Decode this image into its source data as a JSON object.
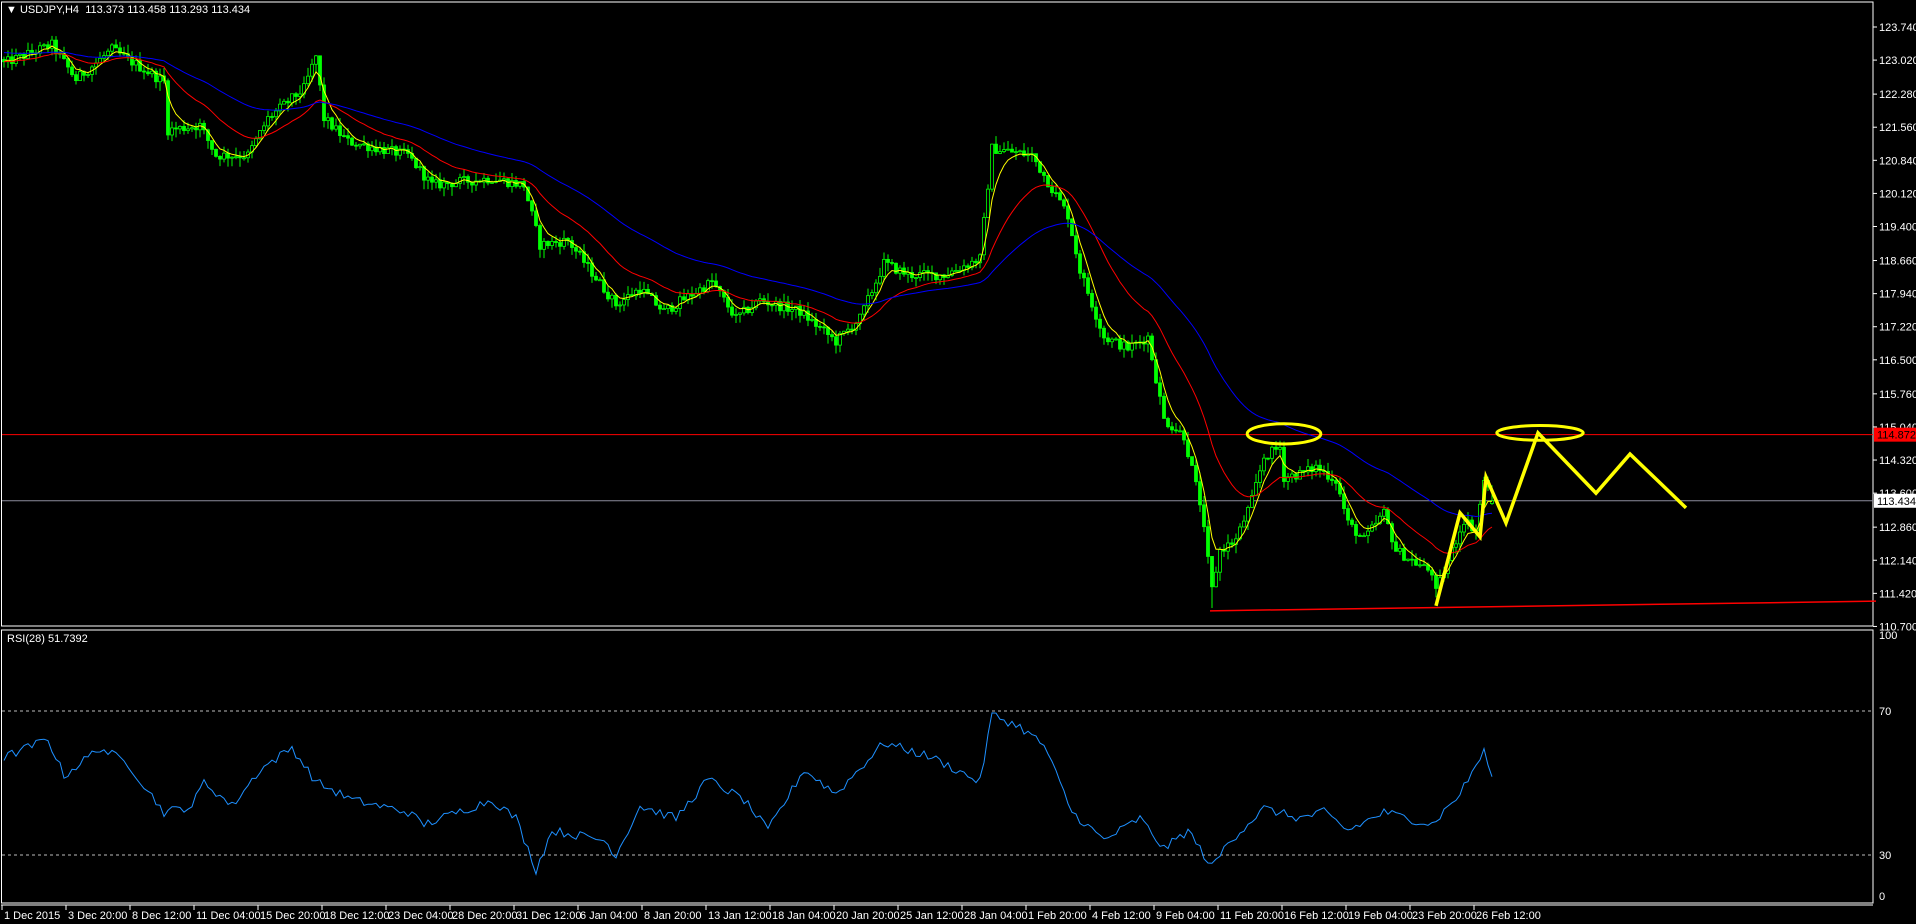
{
  "window": {
    "menu_arrow_icon": "triangle-down",
    "symbol_header": "USDJPY,H4",
    "ohlc": "113.373 113.458 113.293 113.434"
  },
  "indicator": {
    "label": "RSI(28) 51.7392"
  },
  "colors": {
    "background": "#000000",
    "candle": "#00ff00",
    "axis": "#ffffff",
    "ma_fast": "#ffff00",
    "ma_mid": "#ff0000",
    "ma_slow": "#0000ff",
    "resistance": "#ff0000",
    "current": "#8c8c9c",
    "trendline": "#ff0000",
    "annotation": "#ffff00",
    "rsi": "#1e90ff"
  },
  "chart_data": {
    "type": "candlestick",
    "symbol": "USDJPY",
    "timeframe": "H4",
    "last": {
      "open": 113.373,
      "high": 113.458,
      "low": 113.293,
      "close": 113.434
    },
    "price_axis": {
      "min": 110.7,
      "max": 123.74,
      "labels": [
        "123.740",
        "123.020",
        "122.280",
        "121.560",
        "120.840",
        "120.120",
        "119.400",
        "118.660",
        "117.940",
        "117.220",
        "116.500",
        "115.760",
        "115.040",
        "114.320",
        "113.600",
        "112.860",
        "112.140",
        "111.420",
        "110.700"
      ]
    },
    "time_labels": [
      "1 Dec 2015",
      "3 Dec 20:00",
      "8 Dec 12:00",
      "11 Dec 04:00",
      "15 Dec 20:00",
      "18 Dec 12:00",
      "23 Dec 04:00",
      "28 Dec 20:00",
      "31 Dec 12:00",
      "6 Jan 04:00",
      "8 Jan 20:00",
      "13 Jan 12:00",
      "18 Jan 04:00",
      "20 Jan 20:00",
      "25 Jan 12:00",
      "28 Jan 04:00",
      "1 Feb 20:00",
      "4 Feb 12:00",
      "9 Feb 04:00",
      "11 Feb 20:00",
      "16 Feb 12:00",
      "19 Feb 04:00",
      "23 Feb 20:00",
      "26 Feb 12:00"
    ],
    "bars_per_time_label": 16,
    "close_path": [
      [
        0,
        122.95
      ],
      [
        12,
        123.35
      ],
      [
        18,
        122.6
      ],
      [
        27,
        123.25
      ],
      [
        40,
        122.55
      ],
      [
        41,
        121.5
      ],
      [
        49,
        121.6
      ],
      [
        53,
        120.95
      ],
      [
        61,
        120.95
      ],
      [
        66,
        121.75
      ],
      [
        75,
        122.4
      ],
      [
        78,
        123.1
      ],
      [
        80,
        121.75
      ],
      [
        86,
        121.25
      ],
      [
        101,
        120.95
      ],
      [
        107,
        120.3
      ],
      [
        122,
        120.45
      ],
      [
        130,
        120.3
      ],
      [
        134,
        119.0
      ],
      [
        141,
        119.1
      ],
      [
        153,
        117.7
      ],
      [
        159,
        118.05
      ],
      [
        165,
        117.55
      ],
      [
        177,
        118.2
      ],
      [
        183,
        117.4
      ],
      [
        189,
        117.8
      ],
      [
        199,
        117.55
      ],
      [
        208,
        116.9
      ],
      [
        214,
        117.4
      ],
      [
        220,
        118.6
      ],
      [
        226,
        118.35
      ],
      [
        235,
        118.35
      ],
      [
        244,
        118.7
      ],
      [
        247,
        121.1
      ],
      [
        257,
        120.95
      ],
      [
        266,
        119.65
      ],
      [
        269,
        118.45
      ],
      [
        275,
        117.0
      ],
      [
        281,
        116.75
      ],
      [
        286,
        117.0
      ],
      [
        290,
        115.2
      ],
      [
        295,
        114.85
      ],
      [
        299,
        113.4
      ],
      [
        302,
        111.5
      ],
      [
        304,
        112.36
      ],
      [
        308,
        112.58
      ],
      [
        312,
        113.45
      ],
      [
        315,
        114.39
      ],
      [
        319,
        114.6
      ],
      [
        320,
        113.95
      ],
      [
        325,
        114.04
      ],
      [
        328,
        114.17
      ],
      [
        333,
        113.88
      ],
      [
        336,
        112.95
      ],
      [
        340,
        112.58
      ],
      [
        345,
        113.17
      ],
      [
        348,
        112.36
      ],
      [
        353,
        112.08
      ],
      [
        357,
        111.88
      ],
      [
        358,
        111.43
      ],
      [
        362,
        112.36
      ],
      [
        365,
        113.02
      ],
      [
        368,
        112.8
      ],
      [
        370,
        113.88
      ],
      [
        371,
        113.67
      ],
      [
        372,
        113.434
      ]
    ],
    "moving_averages": [
      {
        "name": "fast",
        "period": 5
      },
      {
        "name": "mid",
        "period": 21
      },
      {
        "name": "slow",
        "period": 55
      }
    ],
    "levels": {
      "resistance": {
        "price": 114.872,
        "label": "114.872"
      },
      "current": {
        "price": 113.434,
        "label": "113.434"
      }
    },
    "trendline": {
      "from": [
        301.5,
        111.04
      ],
      "to": [
        468,
        111.25
      ]
    },
    "annotations": {
      "zigzag": [
        [
          358,
          111.15
        ],
        [
          364,
          113.17
        ],
        [
          369,
          112.65
        ],
        [
          370.5,
          113.95
        ],
        [
          375.5,
          112.95
        ],
        [
          383.5,
          114.91
        ],
        [
          398,
          113.6
        ],
        [
          406.5,
          114.45
        ],
        [
          420.5,
          113.28
        ]
      ],
      "ellipses": [
        {
          "bar": 320,
          "price": 114.89,
          "bar_radius": 9.2,
          "price_radius": 0.22
        },
        {
          "bar": 384,
          "price": 114.91,
          "bar_radius": 10.8,
          "price_radius": 0.16
        }
      ]
    },
    "rsi": {
      "period": 28,
      "value": 51.7392,
      "range": [
        0,
        100
      ],
      "levels": [
        70,
        30
      ],
      "axis_labels": [
        "100",
        "70",
        "30",
        "0"
      ],
      "path": [
        [
          0,
          57.1
        ],
        [
          11,
          62.2
        ],
        [
          15,
          52.0
        ],
        [
          24,
          59.8
        ],
        [
          31,
          55.4
        ],
        [
          40,
          41.9
        ],
        [
          47,
          43.6
        ],
        [
          50,
          50.3
        ],
        [
          57,
          43.6
        ],
        [
          64,
          53.7
        ],
        [
          72,
          59.8
        ],
        [
          78,
          50.3
        ],
        [
          87,
          45.3
        ],
        [
          101,
          41.9
        ],
        [
          105,
          38.5
        ],
        [
          122,
          45.3
        ],
        [
          128,
          40.2
        ],
        [
          133,
          25.9
        ],
        [
          137,
          36.8
        ],
        [
          150,
          34.1
        ],
        [
          153,
          30
        ],
        [
          159,
          43.6
        ],
        [
          168,
          40.2
        ],
        [
          176,
          51.0
        ],
        [
          185,
          45.3
        ],
        [
          191,
          36.8
        ],
        [
          200,
          53.7
        ],
        [
          208,
          47.0
        ],
        [
          220,
          61.2
        ],
        [
          232,
          57.1
        ],
        [
          238,
          53.7
        ],
        [
          244,
          50.3
        ],
        [
          247,
          69.0
        ],
        [
          254,
          65.6
        ],
        [
          260,
          60.5
        ],
        [
          267,
          41.9
        ],
        [
          275,
          34.1
        ],
        [
          284,
          40.2
        ],
        [
          290,
          31.7
        ],
        [
          296,
          36.8
        ],
        [
          302,
          26.6
        ],
        [
          306,
          33.4
        ],
        [
          315,
          42.9
        ],
        [
          324,
          40.2
        ],
        [
          330,
          41.9
        ],
        [
          336,
          36.8
        ],
        [
          345,
          41.9
        ],
        [
          351,
          40.2
        ],
        [
          357,
          38.5
        ],
        [
          364,
          47.0
        ],
        [
          370,
          58.8
        ],
        [
          372,
          51.74
        ]
      ]
    }
  }
}
